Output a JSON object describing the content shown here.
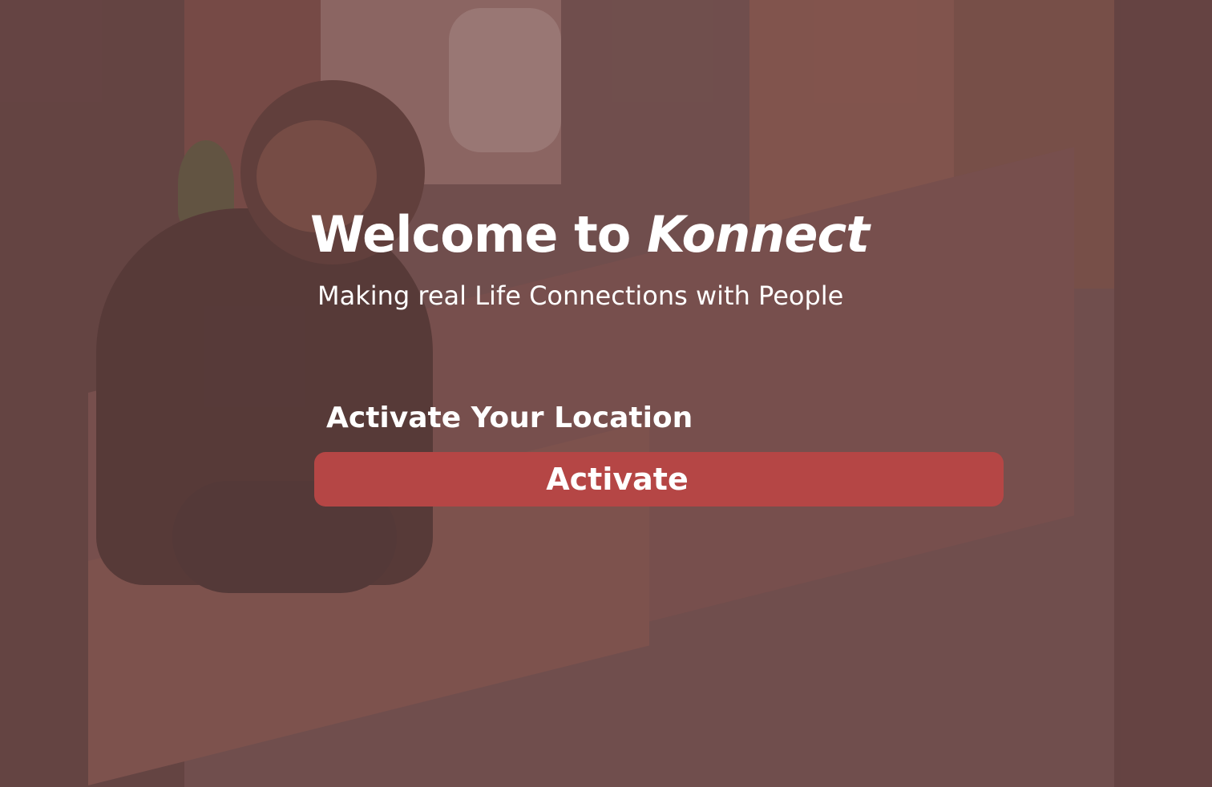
{
  "hero": {
    "title_prefix": "Welcome to ",
    "brand_name": "Konnect",
    "subtitle": "Making real Life Connections with People"
  },
  "location": {
    "heading": "Activate Your Location",
    "button_label": "Activate"
  },
  "colors": {
    "overlay": "#705150",
    "button": "#b54645",
    "text": "#ffffff"
  }
}
